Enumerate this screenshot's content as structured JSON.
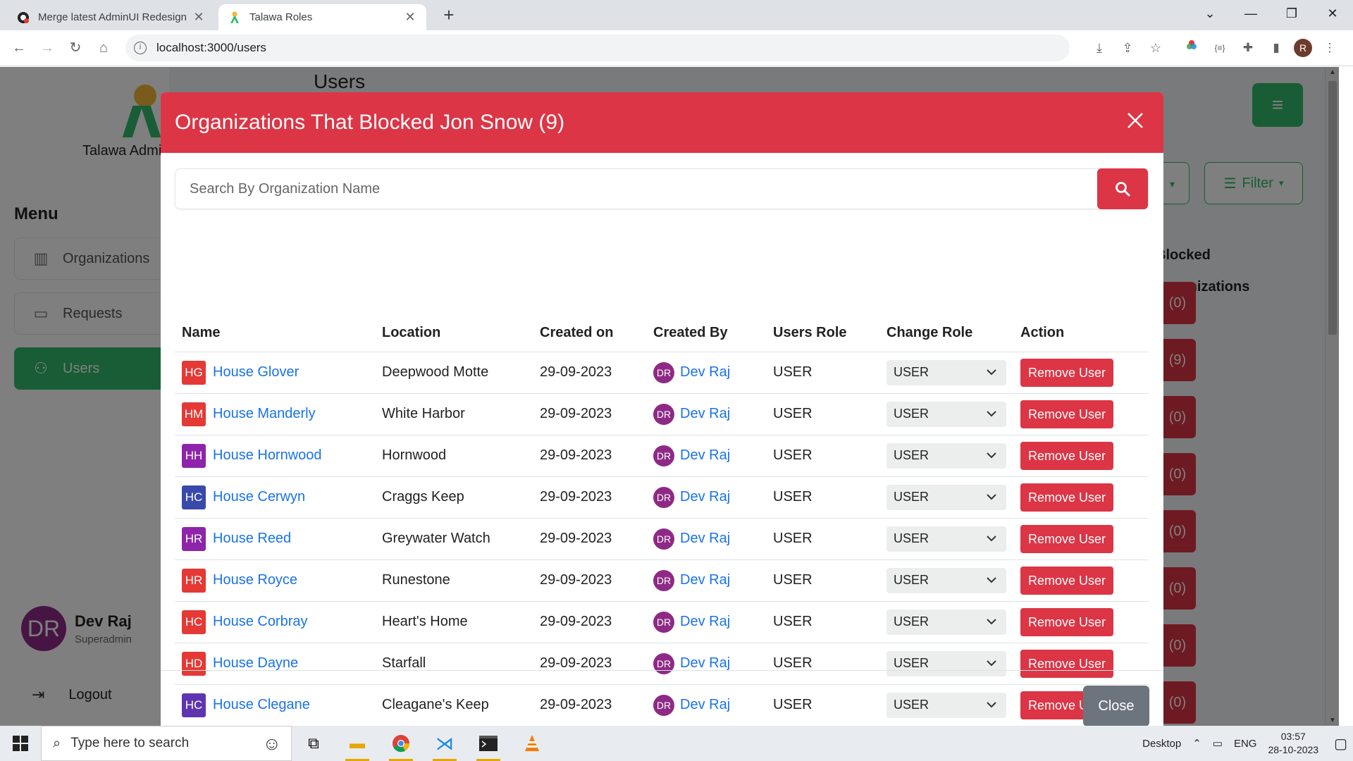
{
  "browser": {
    "tabs": [
      {
        "title": "Merge latest AdminUI Redesign",
        "active": false
      },
      {
        "title": "Talawa Roles",
        "active": true
      }
    ],
    "new_tab": "+",
    "url": "localhost:3000/users",
    "profile_initial": "R"
  },
  "sidebar": {
    "brand": "Talawa Admin",
    "menu_title": "Menu",
    "items": [
      {
        "label": "Organizations",
        "icon": "organizations-icon"
      },
      {
        "label": "Requests",
        "icon": "requests-icon"
      },
      {
        "label": "Users",
        "icon": "users-icon",
        "active": true
      }
    ],
    "profile": {
      "initials": "DR",
      "name": "Dev Raj",
      "role": "Superadmin"
    },
    "logout": "Logout"
  },
  "background_page": {
    "heading": "Users",
    "filter": "Filter",
    "column_header": "Blocked Organizations",
    "counts": [
      "(0)",
      "(9)",
      "(0)",
      "(0)",
      "(0)",
      "(0)",
      "(0)",
      "(0)"
    ]
  },
  "modal": {
    "title": "Organizations That Blocked Jon Snow (9)",
    "search_placeholder": "Search By Organization Name",
    "columns": [
      "Name",
      "Location",
      "Created on",
      "Created By",
      "Users Role",
      "Change Role",
      "Action"
    ],
    "rows": [
      {
        "initials": "HG",
        "color": "#e53935",
        "name": "House Glover",
        "location": "Deepwood Motte",
        "created_on": "29-09-2023",
        "creator_initials": "DR",
        "created_by": "Dev Raj",
        "role": "USER",
        "change_role": "USER",
        "action": "Remove User"
      },
      {
        "initials": "HM",
        "color": "#e53935",
        "name": "House Manderly",
        "location": "White Harbor",
        "created_on": "29-09-2023",
        "creator_initials": "DR",
        "created_by": "Dev Raj",
        "role": "USER",
        "change_role": "USER",
        "action": "Remove User"
      },
      {
        "initials": "HH",
        "color": "#8e24aa",
        "name": "House Hornwood",
        "location": "Hornwood",
        "created_on": "29-09-2023",
        "creator_initials": "DR",
        "created_by": "Dev Raj",
        "role": "USER",
        "change_role": "USER",
        "action": "Remove User"
      },
      {
        "initials": "HC",
        "color": "#3949ab",
        "name": "House Cerwyn",
        "location": "Craggs Keep",
        "created_on": "29-09-2023",
        "creator_initials": "DR",
        "created_by": "Dev Raj",
        "role": "USER",
        "change_role": "USER",
        "action": "Remove User"
      },
      {
        "initials": "HR",
        "color": "#8e24aa",
        "name": "House Reed",
        "location": "Greywater Watch",
        "created_on": "29-09-2023",
        "creator_initials": "DR",
        "created_by": "Dev Raj",
        "role": "USER",
        "change_role": "USER",
        "action": "Remove User"
      },
      {
        "initials": "HR",
        "color": "#e53935",
        "name": "House Royce",
        "location": "Runestone",
        "created_on": "29-09-2023",
        "creator_initials": "DR",
        "created_by": "Dev Raj",
        "role": "USER",
        "change_role": "USER",
        "action": "Remove User"
      },
      {
        "initials": "HC",
        "color": "#e53935",
        "name": "House Corbray",
        "location": "Heart's Home",
        "created_on": "29-09-2023",
        "creator_initials": "DR",
        "created_by": "Dev Raj",
        "role": "USER",
        "change_role": "USER",
        "action": "Remove User"
      },
      {
        "initials": "HD",
        "color": "#e53935",
        "name": "House Dayne",
        "location": "Starfall",
        "created_on": "29-09-2023",
        "creator_initials": "DR",
        "created_by": "Dev Raj",
        "role": "USER",
        "change_role": "USER",
        "action": "Remove User"
      },
      {
        "initials": "HC",
        "color": "#5e35b1",
        "name": "House Clegane",
        "location": "Cleagane's Keep",
        "created_on": "29-09-2023",
        "creator_initials": "DR",
        "created_by": "Dev Raj",
        "role": "USER",
        "change_role": "USER",
        "action": "Remove User"
      }
    ],
    "close_label": "Close"
  },
  "taskbar": {
    "search_placeholder": "Type here to search",
    "desktop": "Desktop",
    "lang": "ENG",
    "time": "03:57",
    "date": "28-10-2023"
  },
  "colors": {
    "accent": "#dc3545",
    "brand_green": "#31bb6b",
    "link": "#1a73e8"
  }
}
